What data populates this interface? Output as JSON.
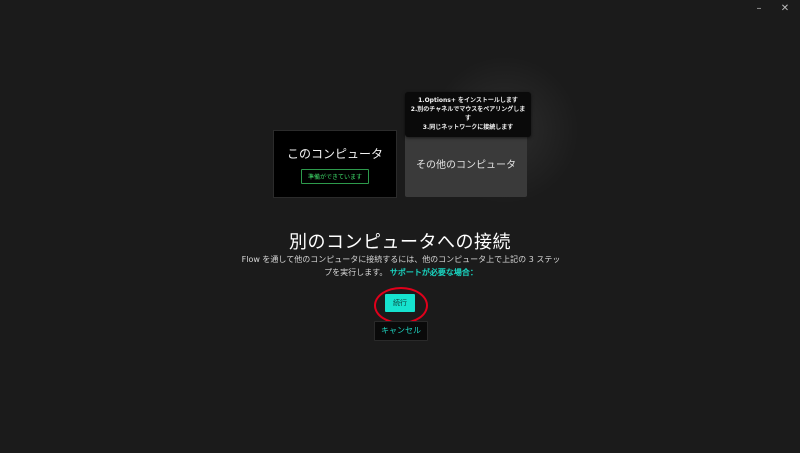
{
  "window_controls": {
    "minimize_glyph": "–",
    "close_glyph": "✕"
  },
  "diagram": {
    "this_computer": {
      "title": "このコンピュータ",
      "status": "準備ができています"
    },
    "other_computer": {
      "title": "その他のコンピュータ"
    },
    "steps_tooltip": {
      "steps": [
        "1.Options+ をインストールします",
        "2.別のチャネルでマウスをペアリングします",
        "3.同じネットワークに接続します"
      ]
    }
  },
  "main": {
    "heading": "別のコンピュータへの接続",
    "description": "Flow を通して他のコンピュータに接続するには、他のコンピュータ上で上記の 3 ステップを実行します。",
    "help_link": "サポートが必要な場合："
  },
  "buttons": {
    "next_label": "続行",
    "cancel_label": "キャンセル"
  },
  "colors": {
    "background": "#1b1b1b",
    "accent": "#16e3cf",
    "ready_green": "#3fdc6a",
    "highlight_red": "#e0001b"
  }
}
